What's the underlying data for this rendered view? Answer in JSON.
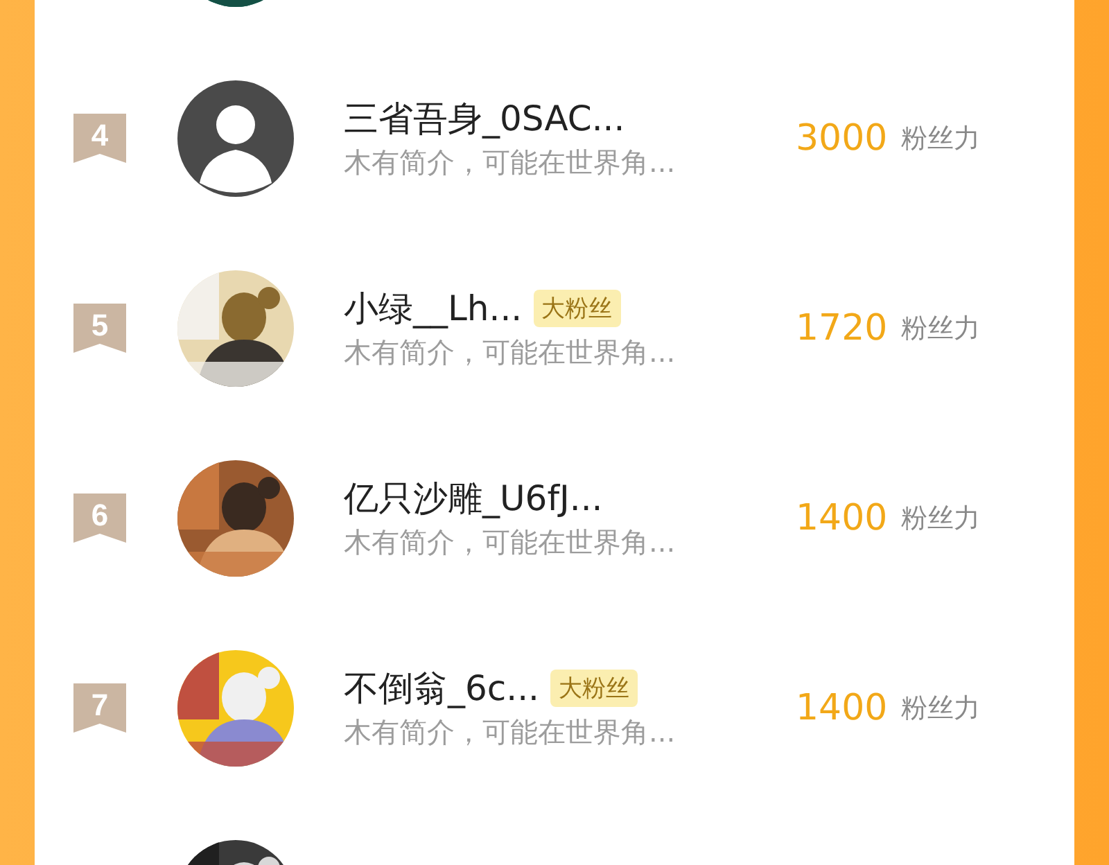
{
  "rows": [
    {
      "rank": "4",
      "avatar": {
        "kind": "default"
      },
      "name": "三省吾身_0SAC...",
      "bio": "木有简介，可能在世界角...",
      "score": "3000",
      "unit": "粉丝力"
    },
    {
      "rank": "5",
      "name": "小绿__Lh...",
      "badge": "大粉丝",
      "bio": "木有简介，可能在世界角...",
      "score": "1720",
      "unit": "粉丝力"
    },
    {
      "rank": "6",
      "name": "亿只沙雕_U6fJ...",
      "bio": "木有简介，可能在世界角...",
      "score": "1400",
      "unit": "粉丝力"
    },
    {
      "rank": "7",
      "name": "不倒翁_6c...",
      "badge": "大粉丝",
      "bio": "木有简介，可能在世界角...",
      "score": "1400",
      "unit": "粉丝力"
    }
  ]
}
